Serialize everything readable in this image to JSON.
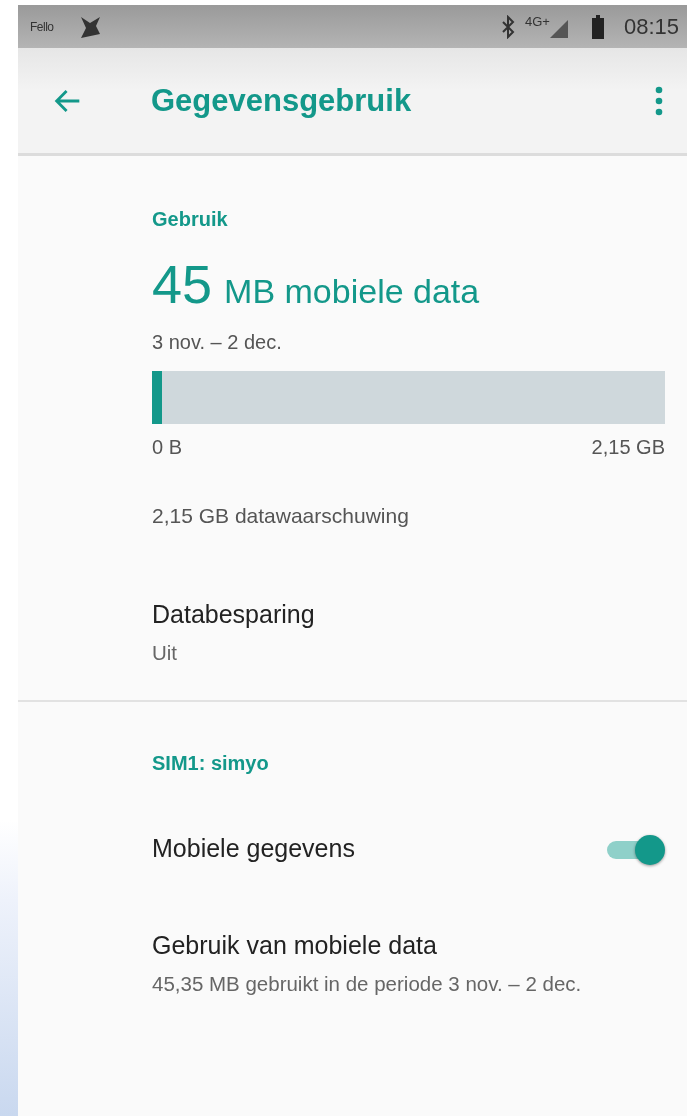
{
  "status_bar": {
    "carrier": "Fello",
    "network": "4G+",
    "time": "08:15"
  },
  "app_bar": {
    "title": "Gegevensgebruik"
  },
  "usage": {
    "header": "Gebruik",
    "amount": "45",
    "unit": "MB mobiele data",
    "period": "3 nov. – 2 dec.",
    "meter": {
      "level": 0.02,
      "min_label": "0 B",
      "max_label": "2,15 GB"
    },
    "warning": "2,15 GB datawaarschuwing"
  },
  "data_saver": {
    "title": "Databesparing",
    "value": "Uit"
  },
  "sim": {
    "header": "SIM1: simyo",
    "items": [
      {
        "kind": "toggle",
        "title": "Mobiele gegevens",
        "on": true
      },
      {
        "kind": "text",
        "title": "Gebruik van mobiele data",
        "subtitle": "45,35 MB gebruikt in de periode 3 nov. – 2 dec."
      }
    ]
  }
}
